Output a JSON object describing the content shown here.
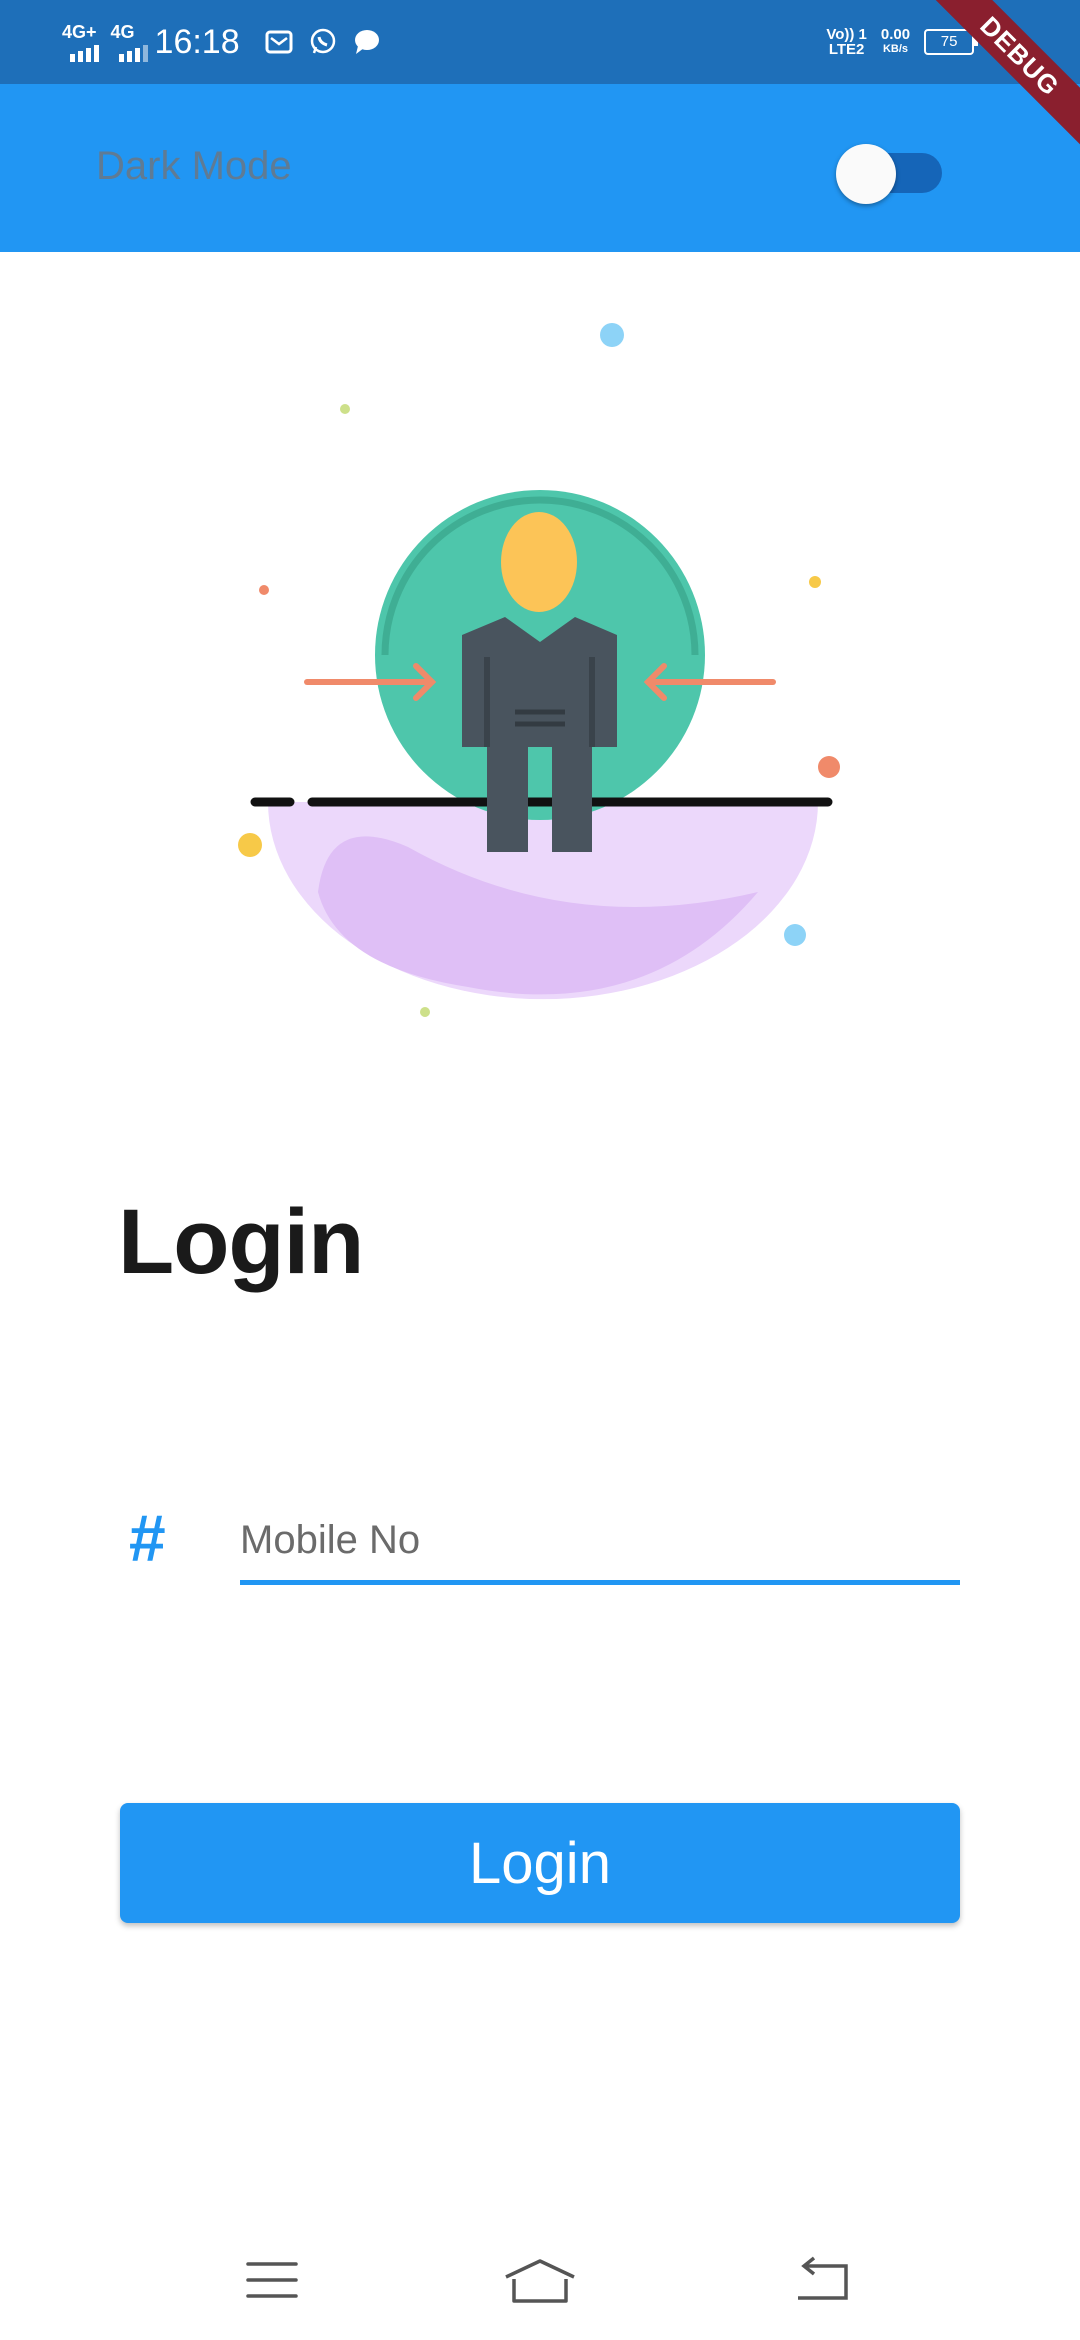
{
  "status_bar": {
    "network1": "4G+",
    "network2": "4G",
    "time": "16:18",
    "volte": "Vo)) 1",
    "lte": "LTE2",
    "speed_value": "0.00",
    "speed_unit": "KB/s",
    "battery": "75",
    "notification_icons": [
      "mail-icon",
      "whatsapp-icon",
      "message-icon"
    ]
  },
  "debug_banner": "DEBUG",
  "app_bar": {
    "dark_mode_label": "Dark Mode",
    "dark_mode_on": false,
    "background": "#2196f3"
  },
  "main": {
    "heading": "Login",
    "mobile_field": {
      "placeholder": "Mobile No",
      "value": "",
      "icon": "hash-icon"
    },
    "login_button_label": "Login",
    "accent": "#2196f3"
  },
  "nav_bar": {
    "items": [
      "menu-icon",
      "home-icon",
      "back-icon"
    ]
  }
}
